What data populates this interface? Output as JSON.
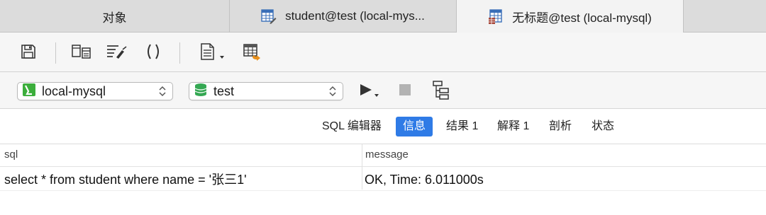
{
  "tabs": [
    {
      "label": "对象",
      "icon": "",
      "active": false
    },
    {
      "label": "student@test (local-mys...",
      "icon": "table-edit-icon",
      "active": false
    },
    {
      "label": "无标题@test (local-mysql)",
      "icon": "query-table-icon",
      "active": true
    }
  ],
  "toolbar": {
    "buttons": [
      "save-icon",
      "query-builder-icon",
      "beautify-sql-icon",
      "parentheses-icon",
      "code-snippet-icon",
      "export-result-icon"
    ]
  },
  "connection": {
    "selected": "local-mysql",
    "icon": "mysql-connection-icon"
  },
  "database": {
    "selected": "test",
    "icon": "database-icon"
  },
  "run_controls": [
    "run-icon",
    "stop-icon",
    "explain-icon"
  ],
  "subtabs": [
    {
      "label": "SQL 编辑器",
      "active": false
    },
    {
      "label": "信息",
      "active": true
    },
    {
      "label": "结果 1",
      "active": false
    },
    {
      "label": "解释 1",
      "active": false
    },
    {
      "label": "剖析",
      "active": false
    },
    {
      "label": "状态",
      "active": false
    }
  ],
  "grid": {
    "columns": [
      "sql",
      "message"
    ],
    "rows": [
      [
        "select * from student where name = '张三1'",
        "OK, Time: 6.011000s"
      ]
    ]
  },
  "colors": {
    "active_subtab": "#2f7be6",
    "tabbar": "#dcdcdc",
    "toolbar": "#f6f6f6",
    "db_icon": "#35a853",
    "conn_icon": "#3cae3c"
  }
}
